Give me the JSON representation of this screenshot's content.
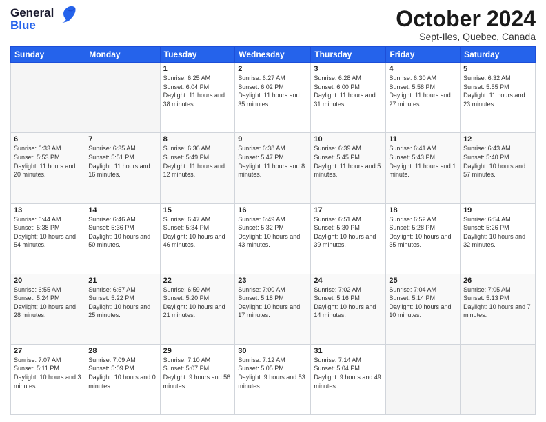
{
  "header": {
    "logo_line1": "General",
    "logo_line2": "Blue",
    "month": "October 2024",
    "location": "Sept-Iles, Quebec, Canada"
  },
  "days_of_week": [
    "Sunday",
    "Monday",
    "Tuesday",
    "Wednesday",
    "Thursday",
    "Friday",
    "Saturday"
  ],
  "weeks": [
    [
      {
        "day": "",
        "info": ""
      },
      {
        "day": "",
        "info": ""
      },
      {
        "day": "1",
        "info": "Sunrise: 6:25 AM\nSunset: 6:04 PM\nDaylight: 11 hours and 38 minutes."
      },
      {
        "day": "2",
        "info": "Sunrise: 6:27 AM\nSunset: 6:02 PM\nDaylight: 11 hours and 35 minutes."
      },
      {
        "day": "3",
        "info": "Sunrise: 6:28 AM\nSunset: 6:00 PM\nDaylight: 11 hours and 31 minutes."
      },
      {
        "day": "4",
        "info": "Sunrise: 6:30 AM\nSunset: 5:58 PM\nDaylight: 11 hours and 27 minutes."
      },
      {
        "day": "5",
        "info": "Sunrise: 6:32 AM\nSunset: 5:55 PM\nDaylight: 11 hours and 23 minutes."
      }
    ],
    [
      {
        "day": "6",
        "info": "Sunrise: 6:33 AM\nSunset: 5:53 PM\nDaylight: 11 hours and 20 minutes."
      },
      {
        "day": "7",
        "info": "Sunrise: 6:35 AM\nSunset: 5:51 PM\nDaylight: 11 hours and 16 minutes."
      },
      {
        "day": "8",
        "info": "Sunrise: 6:36 AM\nSunset: 5:49 PM\nDaylight: 11 hours and 12 minutes."
      },
      {
        "day": "9",
        "info": "Sunrise: 6:38 AM\nSunset: 5:47 PM\nDaylight: 11 hours and 8 minutes."
      },
      {
        "day": "10",
        "info": "Sunrise: 6:39 AM\nSunset: 5:45 PM\nDaylight: 11 hours and 5 minutes."
      },
      {
        "day": "11",
        "info": "Sunrise: 6:41 AM\nSunset: 5:43 PM\nDaylight: 11 hours and 1 minute."
      },
      {
        "day": "12",
        "info": "Sunrise: 6:43 AM\nSunset: 5:40 PM\nDaylight: 10 hours and 57 minutes."
      }
    ],
    [
      {
        "day": "13",
        "info": "Sunrise: 6:44 AM\nSunset: 5:38 PM\nDaylight: 10 hours and 54 minutes."
      },
      {
        "day": "14",
        "info": "Sunrise: 6:46 AM\nSunset: 5:36 PM\nDaylight: 10 hours and 50 minutes."
      },
      {
        "day": "15",
        "info": "Sunrise: 6:47 AM\nSunset: 5:34 PM\nDaylight: 10 hours and 46 minutes."
      },
      {
        "day": "16",
        "info": "Sunrise: 6:49 AM\nSunset: 5:32 PM\nDaylight: 10 hours and 43 minutes."
      },
      {
        "day": "17",
        "info": "Sunrise: 6:51 AM\nSunset: 5:30 PM\nDaylight: 10 hours and 39 minutes."
      },
      {
        "day": "18",
        "info": "Sunrise: 6:52 AM\nSunset: 5:28 PM\nDaylight: 10 hours and 35 minutes."
      },
      {
        "day": "19",
        "info": "Sunrise: 6:54 AM\nSunset: 5:26 PM\nDaylight: 10 hours and 32 minutes."
      }
    ],
    [
      {
        "day": "20",
        "info": "Sunrise: 6:55 AM\nSunset: 5:24 PM\nDaylight: 10 hours and 28 minutes."
      },
      {
        "day": "21",
        "info": "Sunrise: 6:57 AM\nSunset: 5:22 PM\nDaylight: 10 hours and 25 minutes."
      },
      {
        "day": "22",
        "info": "Sunrise: 6:59 AM\nSunset: 5:20 PM\nDaylight: 10 hours and 21 minutes."
      },
      {
        "day": "23",
        "info": "Sunrise: 7:00 AM\nSunset: 5:18 PM\nDaylight: 10 hours and 17 minutes."
      },
      {
        "day": "24",
        "info": "Sunrise: 7:02 AM\nSunset: 5:16 PM\nDaylight: 10 hours and 14 minutes."
      },
      {
        "day": "25",
        "info": "Sunrise: 7:04 AM\nSunset: 5:14 PM\nDaylight: 10 hours and 10 minutes."
      },
      {
        "day": "26",
        "info": "Sunrise: 7:05 AM\nSunset: 5:13 PM\nDaylight: 10 hours and 7 minutes."
      }
    ],
    [
      {
        "day": "27",
        "info": "Sunrise: 7:07 AM\nSunset: 5:11 PM\nDaylight: 10 hours and 3 minutes."
      },
      {
        "day": "28",
        "info": "Sunrise: 7:09 AM\nSunset: 5:09 PM\nDaylight: 10 hours and 0 minutes."
      },
      {
        "day": "29",
        "info": "Sunrise: 7:10 AM\nSunset: 5:07 PM\nDaylight: 9 hours and 56 minutes."
      },
      {
        "day": "30",
        "info": "Sunrise: 7:12 AM\nSunset: 5:05 PM\nDaylight: 9 hours and 53 minutes."
      },
      {
        "day": "31",
        "info": "Sunrise: 7:14 AM\nSunset: 5:04 PM\nDaylight: 9 hours and 49 minutes."
      },
      {
        "day": "",
        "info": ""
      },
      {
        "day": "",
        "info": ""
      }
    ]
  ]
}
